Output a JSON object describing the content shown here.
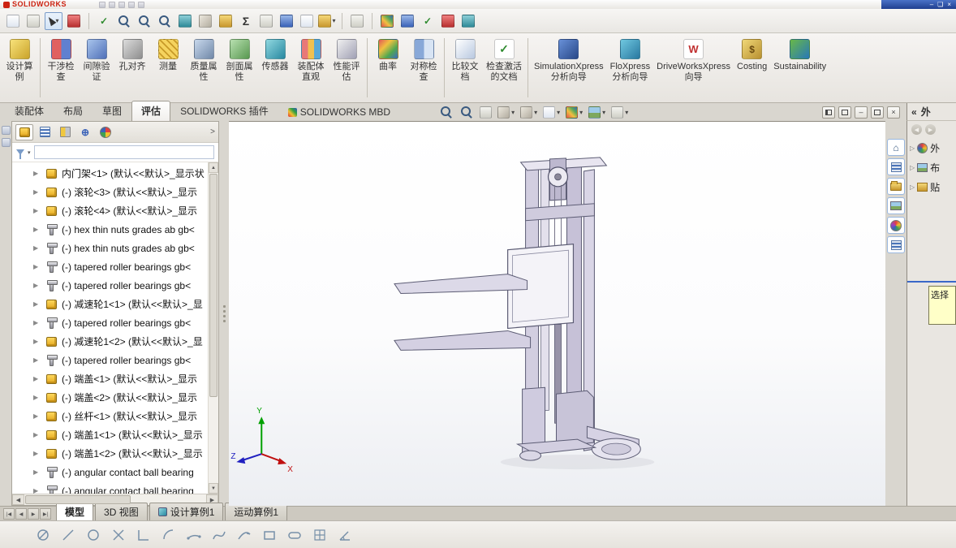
{
  "titlebar": {
    "brand": "SOLIDWORKS",
    "window_controls": {
      "minimize": "–",
      "restore": "❏",
      "close": "×"
    }
  },
  "menu_toolbar": {
    "icons": [
      "summary-info",
      "file-properties",
      "select-arrow",
      "stop-macro",
      "spell-check",
      "zoom-to-fit",
      "zoom-to-area",
      "zoom-in-out",
      "rotate-view",
      "pan-view",
      "measure",
      "equations-sigma",
      "trim-entities",
      "mirror-entities",
      "copy-document",
      "edit-annotation",
      "design-table",
      "exploded-view",
      "render-globe",
      "check-ok",
      "record-macro",
      "web-help"
    ]
  },
  "ribbon": {
    "buttons": [
      {
        "name": "design-study",
        "label": "设计算\n例"
      },
      {
        "name": "interference-detection",
        "label": "干涉检\n查"
      },
      {
        "name": "clearance-verification",
        "label": "间隙验\n证"
      },
      {
        "name": "hole-alignment",
        "label": "孔对齐"
      },
      {
        "name": "measure",
        "label": "测量"
      },
      {
        "name": "mass-properties",
        "label": "质量属\n性"
      },
      {
        "name": "section-properties",
        "label": "剖面属\n性"
      },
      {
        "name": "sensor",
        "label": "传感器"
      },
      {
        "name": "assembly-visualization",
        "label": "装配体\n直观"
      },
      {
        "name": "performance-evaluation",
        "label": "性能评\n估"
      },
      {
        "name": "curvature",
        "label": "曲率"
      },
      {
        "name": "symmetry-check",
        "label": "对称检\n查"
      },
      {
        "name": "compare-documents",
        "label": "比较文\n档"
      },
      {
        "name": "check-active-document",
        "label": "检查激活\n的文档"
      },
      {
        "name": "simulationxpress-wizard",
        "label": "SimulationXpress\n分析向导"
      },
      {
        "name": "floxpress-wizard",
        "label": "FloXpress\n分析向导"
      },
      {
        "name": "driveworksxpress-wizard",
        "label": "DriveWorksXpress\n向导"
      },
      {
        "name": "costing",
        "label": "Costing"
      },
      {
        "name": "sustainability",
        "label": "Sustainability"
      }
    ]
  },
  "doc_tabs": {
    "items": [
      "装配体",
      "布局",
      "草图",
      "评估",
      "SOLIDWORKS 插件",
      "SOLIDWORKS MBD"
    ],
    "active": "评估"
  },
  "headsup": {
    "icons": [
      "zoom-to-fit",
      "zoom-to-area",
      "section-view",
      "view-orientation",
      "display-style",
      "hide-show-items",
      "edit-appearance",
      "apply-scene",
      "view-settings"
    ]
  },
  "feature_manager": {
    "tabs": [
      "featuremanager-tree",
      "propertymanager",
      "configurationmanager",
      "dimxpertmanager",
      "displaymanager"
    ],
    "filter_value": "",
    "items": [
      {
        "icon": "part",
        "text": "内门架<1> (默认<<默认>_显示状"
      },
      {
        "icon": "part",
        "text": "(-) 滚轮<3> (默认<<默认>_显示"
      },
      {
        "icon": "part",
        "text": "(-) 滚轮<4> (默认<<默认>_显示"
      },
      {
        "icon": "bolt",
        "text": "(-) hex thin nuts grades ab gb<"
      },
      {
        "icon": "bolt",
        "text": "(-) hex thin nuts grades ab gb<"
      },
      {
        "icon": "bolt",
        "text": "(-) tapered roller bearings gb<"
      },
      {
        "icon": "bolt",
        "text": "(-) tapered roller bearings gb<"
      },
      {
        "icon": "part",
        "text": "(-) 减速轮1<1> (默认<<默认>_显"
      },
      {
        "icon": "bolt",
        "text": "(-) tapered roller bearings gb<"
      },
      {
        "icon": "part",
        "text": "(-) 减速轮1<2> (默认<<默认>_显"
      },
      {
        "icon": "bolt",
        "text": "(-) tapered roller bearings gb<"
      },
      {
        "icon": "part",
        "text": "(-) 端盖<1> (默认<<默认>_显示"
      },
      {
        "icon": "part",
        "text": "(-) 端盖<2> (默认<<默认>_显示"
      },
      {
        "icon": "part",
        "text": "(-) 丝杆<1> (默认<<默认>_显示"
      },
      {
        "icon": "part",
        "text": "(-) 端盖1<1> (默认<<默认>_显示"
      },
      {
        "icon": "part",
        "text": "(-) 端盖1<2> (默认<<默认>_显示"
      },
      {
        "icon": "bolt",
        "text": "(-) angular contact ball bearing"
      },
      {
        "icon": "bolt",
        "text": "(-) angular contact ball bearing"
      }
    ]
  },
  "viewport": {
    "triad": {
      "x": "X",
      "y": "Y",
      "z": "Z"
    }
  },
  "right_tools": {
    "icons": [
      "home",
      "design-library",
      "file-explorer",
      "view-palette",
      "appearances-wheel",
      "custom-properties"
    ]
  },
  "task_pane": {
    "header": "外",
    "items": [
      {
        "icon": "appearance-ball",
        "label": "外"
      },
      {
        "icon": "scene",
        "label": "布"
      },
      {
        "icon": "decal",
        "label": "贴"
      }
    ],
    "tooltip": "选择"
  },
  "bottom_bar": {
    "tabs": [
      "模型",
      "3D 视图",
      "设计算例1",
      "运动算例1"
    ],
    "active": "模型"
  },
  "sketch_toolbar": {
    "icons": [
      "no-entity",
      "line",
      "circle",
      "trim",
      "corner",
      "arc",
      "three-point-arc",
      "spline",
      "tangent-arc",
      "rectangle",
      "slot",
      "grid",
      "angle-dimension"
    ]
  },
  "colors": {
    "accent_blue": "#2f62b0",
    "brand_red": "#cc2211",
    "tooltip_yellow": "#ffffc8",
    "model_fill": "#d2cee0"
  }
}
